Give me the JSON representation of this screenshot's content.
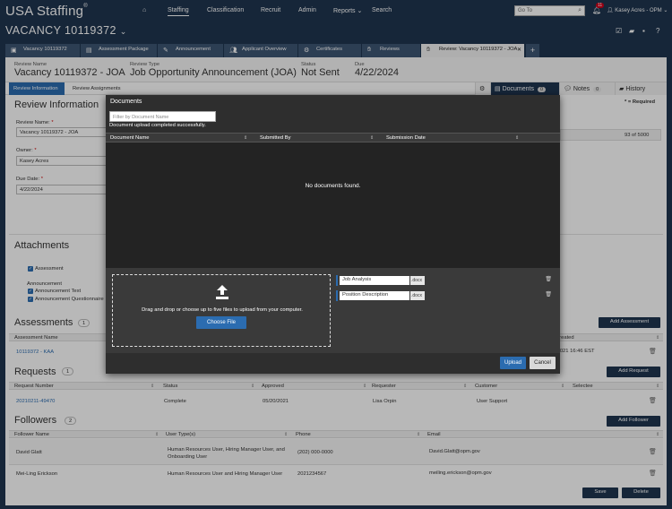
{
  "app": {
    "brand": "USA Staffing",
    "brand_mark": "®"
  },
  "topnav": {
    "home_icon": "home-icon",
    "items": [
      "Staffing",
      "Classification",
      "Recruit",
      "Admin",
      "Reports",
      "Search"
    ],
    "goto_placeholder": "Go To",
    "notification_count": "11",
    "user": "Kasey Acres - OPM"
  },
  "vacancy": {
    "title": "VACANCY 10119372"
  },
  "tabs": [
    {
      "label": "Vacancy 10119372",
      "icon": "vacancy-icon"
    },
    {
      "label": "Assessment Package",
      "icon": "assessment-icon"
    },
    {
      "label": "Announcement",
      "icon": "announcement-icon"
    },
    {
      "label": "Applicant Overview",
      "icon": "applicants-icon"
    },
    {
      "label": "Certificates",
      "icon": "certificate-icon"
    },
    {
      "label": "Reviews",
      "icon": "reviews-icon"
    },
    {
      "label": "Review: Vacancy 10119372 - JOA",
      "icon": "review-icon"
    }
  ],
  "review_header": {
    "review_name_label": "Review Name",
    "review_name": "Vacancy 10119372 - JOA",
    "review_type_label": "Review Type",
    "review_type": "Job Opportunity Announcement (JOA)",
    "status_label": "Status",
    "status": "Not Sent",
    "due_label": "Due",
    "due": "4/22/2024"
  },
  "subtabs": {
    "review_information": "Review Information",
    "review_assignments": "Review Assignments"
  },
  "right_tabs": {
    "documents": "Documents",
    "documents_count": "0",
    "notes": "Notes",
    "notes_count": "0",
    "history": "History"
  },
  "review_info": {
    "title": "Review Information",
    "required_note": "* = Required",
    "review_name_label": "Review Name:",
    "review_name_value": "Vacancy 10119372 - JOA",
    "owner_label": "Owner:",
    "owner_value": "Kasey Acres",
    "due_label": "Due Date:",
    "due_value": "4/22/2024",
    "char_count": "93 of 5000"
  },
  "attachments": {
    "title": "Attachments",
    "assessment": "Assessment",
    "announcement_heading": "Announcement",
    "announcement_text": "Announcement Text",
    "announcement_questionnaire": "Announcement Questionnaire"
  },
  "assessments": {
    "title": "Assessments",
    "count": "1",
    "add_button": "Add Assessment",
    "col_name": "Assessment Name",
    "col_created": "Created",
    "rows": [
      {
        "name": "10119372 - KAA",
        "created": "/2021 16:46 EST"
      }
    ]
  },
  "requests": {
    "title": "Requests",
    "count": "1",
    "add_button": "Add Request",
    "columns": [
      "Request Number",
      "Status",
      "Approved",
      "Requester",
      "Customer",
      "Selectee"
    ],
    "rows": [
      {
        "number": "20210211-49470",
        "status": "Complete",
        "approved": "05/20/2021",
        "requester": "Lisa Orpin",
        "customer": "User Support",
        "selectee": ""
      }
    ]
  },
  "followers": {
    "title": "Followers",
    "count": "2",
    "add_button": "Add Follower",
    "columns": [
      "Follower Name",
      "User Type(s)",
      "Phone",
      "Email"
    ],
    "rows": [
      {
        "name": "David Glatt",
        "types": "Human Resources User, Hiring Manager User, and Onboarding User",
        "phone": "(202) 000-0000",
        "email": "David.Glatt@opm.gov"
      },
      {
        "name": "Mei-Ling Erickson",
        "types": "Human Resources User and Hiring Manager User",
        "phone": "2021234567",
        "email": "meiling.erickson@opm.gov"
      }
    ]
  },
  "footer": {
    "save": "Save",
    "delete": "Delete"
  },
  "modal": {
    "title": "Documents",
    "filter_placeholder": "Filter by Document Name",
    "message": "Document upload completed successfully.",
    "columns": [
      "Document Name",
      "Submitted By",
      "Submission Date"
    ],
    "empty": "No documents found.",
    "drop_text": "Drag and drop or choose up to five files to upload from your computer.",
    "choose_file": "Choose File",
    "files": [
      {
        "name": "Job Analysis",
        "ext": ".docx"
      },
      {
        "name": "Position Description",
        "ext": ".docx"
      }
    ],
    "upload": "Upload",
    "cancel": "Cancel"
  },
  "colors": {
    "navy": "#1f3550",
    "tab": "#3d5674",
    "accent_blue": "#2b6cb0",
    "modal_bg": "#2e2e2e",
    "badge_red": "#d0021b"
  }
}
